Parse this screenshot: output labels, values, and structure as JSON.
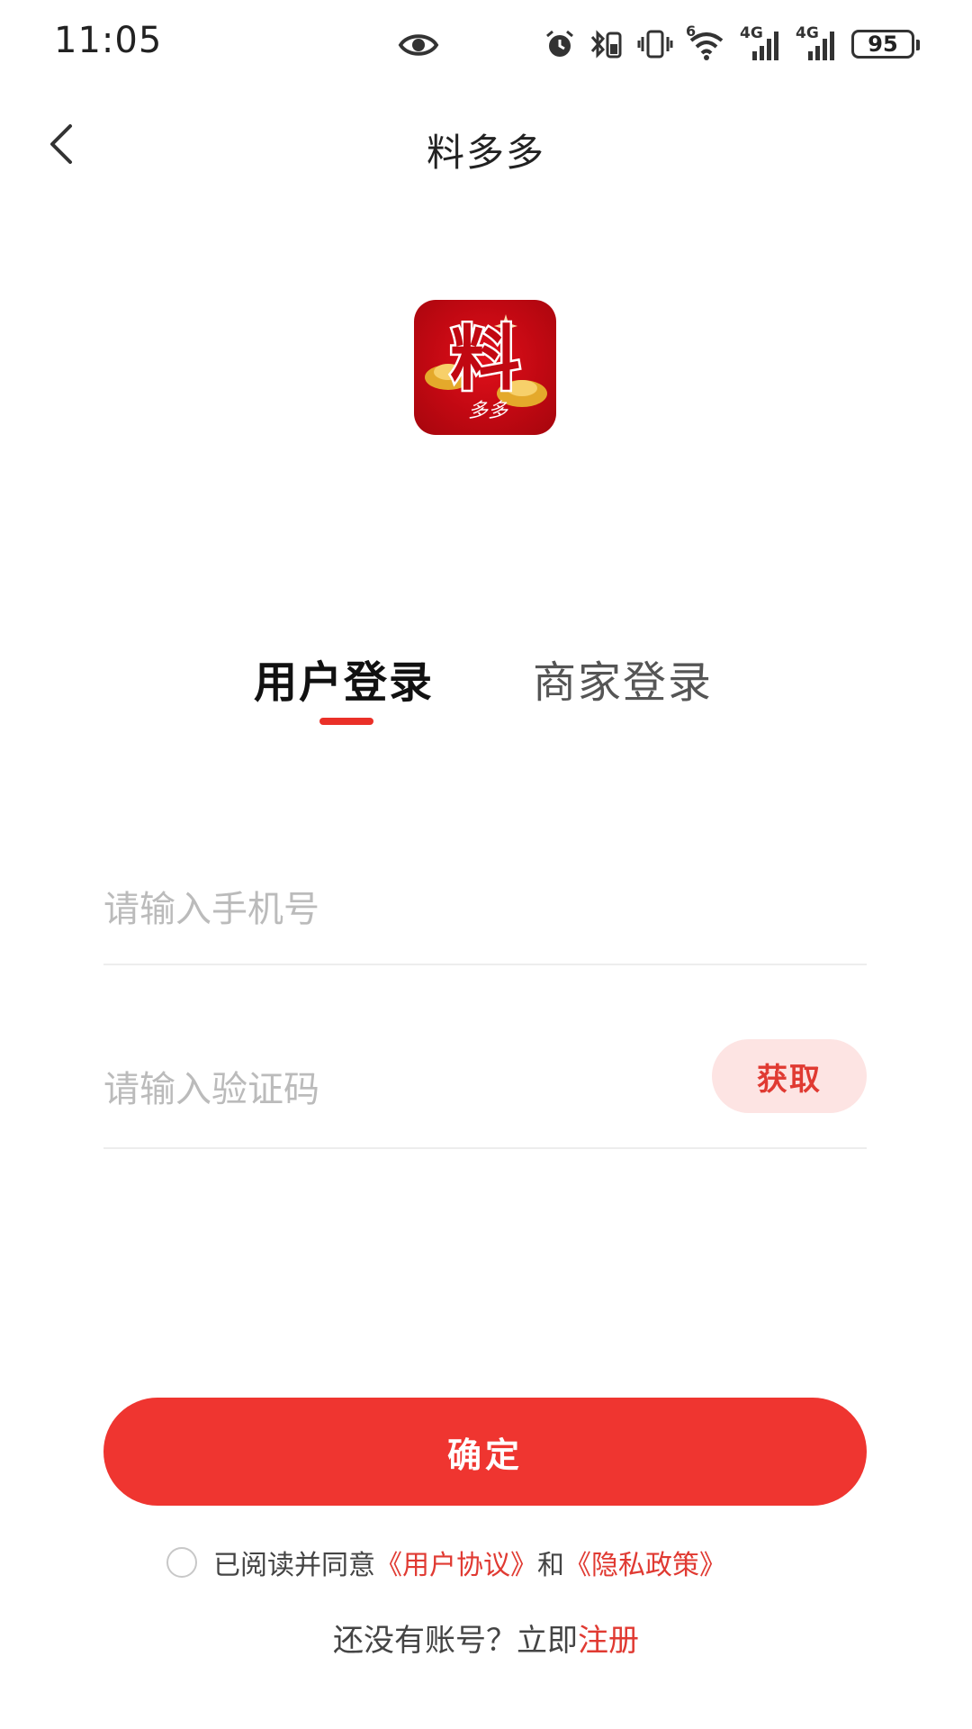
{
  "status_bar": {
    "time": "11:05",
    "battery": "95",
    "network_1": "4G",
    "network_2": "4G",
    "wifi_badge": "6"
  },
  "header": {
    "title": "料多多"
  },
  "logo": {
    "name": "料多多 app logo",
    "big_char": "料",
    "small_text": "多多"
  },
  "tabs": [
    {
      "label": "用户登录",
      "active": true
    },
    {
      "label": "商家登录",
      "active": false
    }
  ],
  "form": {
    "phone_placeholder": "请输入手机号",
    "code_placeholder": "请输入验证码",
    "get_code_label": "获取",
    "confirm_label": "确定"
  },
  "agreement": {
    "prefix": "已阅读并同意",
    "user_agreement": "《用户协议》",
    "and": "和",
    "privacy_policy": "《隐私政策》"
  },
  "register": {
    "prefix": "还没有账号？立即",
    "link": "注册"
  },
  "colors": {
    "accent": "#ef3530",
    "accent_light": "#fde4e3",
    "placeholder": "#bbbbbb"
  }
}
